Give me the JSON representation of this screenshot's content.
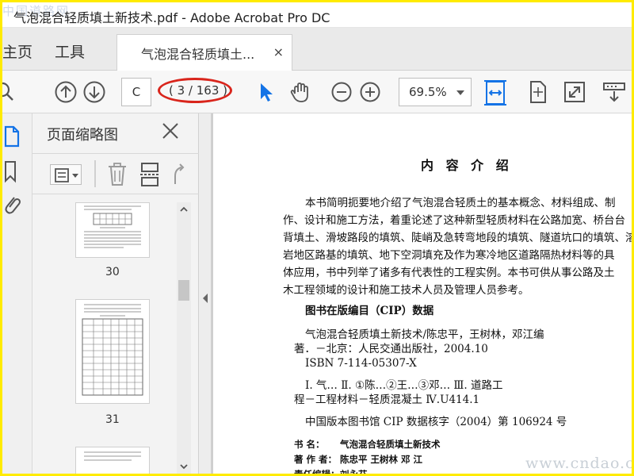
{
  "window": {
    "title": "气泡混合轻质填土新技术.pdf - Adobe Acrobat Pro DC",
    "watermark_top": "中国道路网"
  },
  "tabs": {
    "home": "主页",
    "tools": "工具",
    "document": "气泡混合轻质填土...",
    "close": "×"
  },
  "toolbar": {
    "page_input": "C",
    "page_indicator": "( 3 / 163 )",
    "zoom": "69.5%",
    "accent": "#1473e6",
    "highlight": "#d9251c"
  },
  "thumbnails": {
    "title": "页面缩略图",
    "pages": [
      {
        "number": "30"
      },
      {
        "number": "31"
      }
    ]
  },
  "document": {
    "heading": "内 容 介 绍",
    "summary_lines": [
      "本书简明扼要地介绍了气泡混合轻质土的基本概念、材料组成、制",
      "作、设计和施工方法，着重论述了这种新型轻质材料在公路加宽、桥台台",
      "背填土、滑坡路段的填筑、陡峭及急转弯地段的填筑、隧道坑口的填筑、溶",
      "岩地区路基的填筑、地下空洞填充及作为寒冷地区道路隔热材料等的具",
      "体应用，书中列举了诸多有代表性的工程实例。本书可供从事公路及土",
      "木工程领域的设计和施工技术人员及管理人员参考。"
    ],
    "cip_title": "图书在版编目（CIP）数据",
    "cip_lines": [
      "气泡混合轻质填土新技术/陈忠平，王树林，邓江编",
      "著．－北京：人民交通出版社，2004.10",
      "ISBN 7-114-05307-X"
    ],
    "class_lines": [
      "Ⅰ. 气…  Ⅱ. ①陈…②王…③邓…  Ⅲ. 道路工",
      "程－工程材料－轻质混凝土  Ⅳ.U414.1"
    ],
    "cip_number": "中国版本图书馆 CIP 数据核字（2004）第 106924 号",
    "meta": [
      {
        "label": "书    名：",
        "value": "气泡混合轻质填土新技术"
      },
      {
        "label": "著 作 者：",
        "value": "陈忠平  王树林  邓  江"
      },
      {
        "label": "责任编辑：",
        "value": "刘永芬"
      }
    ],
    "watermark": "www.cndao.com"
  }
}
